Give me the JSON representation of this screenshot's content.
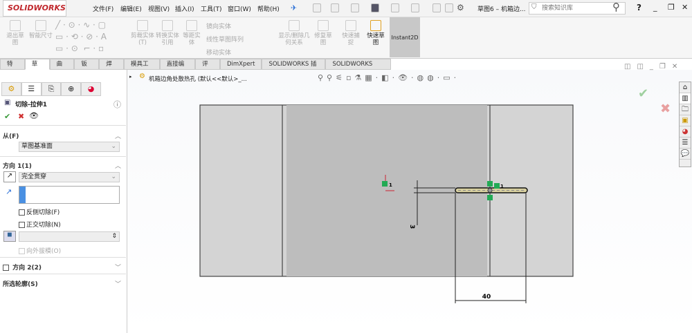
{
  "app": {
    "logo": "SOLIDWORKS",
    "document_title": "草图6 – 机箱边...",
    "search_placeholder": "搜索知识库",
    "help": "?"
  },
  "menu": [
    "文件(F)",
    "编辑(E)",
    "视图(V)",
    "插入(I)",
    "工具(T)",
    "窗口(W)",
    "帮助(H)"
  ],
  "ribbon": {
    "exit_sketch": "退出草图",
    "smart_dim": "智能尺寸",
    "trim": "剪裁实体(T)",
    "convert": "转换实体引用",
    "offset": "等距实体",
    "mirror": "镜向实体",
    "linear_pattern": "线性草图阵列",
    "move": "移动实体",
    "display_relations": "显示/删除几何关系",
    "repair": "修复草图",
    "quick_snap": "快速捕捉",
    "rapid_sketch": "快速草图",
    "instant2d": "Instant2D"
  },
  "tabs": [
    "特征",
    "草图",
    "曲面",
    "钣金",
    "焊件",
    "模具工具",
    "直接编辑",
    "评估",
    "DimXpert",
    "SOLIDWORKS 插件",
    "SOLIDWORKS MBD"
  ],
  "active_tab": 1,
  "panel": {
    "feature_title": "切除-拉伸1",
    "from_label": "从(F)",
    "from_value": "草图基准面",
    "dir1_label": "方向 1(1)",
    "dir1_value": "完全贯穿",
    "flip_side": "反侧切除(F)",
    "normal_cut": "正交切除(N)",
    "draft_outward": "向外拔模(O)",
    "dir2_label": "方向 2(2)",
    "contours_label": "所选轮廓(S)"
  },
  "tree": {
    "item": "机箱边角处散热孔 (默认<<默认>_..."
  },
  "drawing": {
    "dim_width": "40",
    "dim_height": "3",
    "relation_label": "1"
  },
  "colors": {
    "accent": "#1e90ff",
    "confirm": "#3a9a3a",
    "cancel": "#d03030",
    "sketch_dark": "#bdbdbd",
    "sketch_light": "#d4d4d4"
  }
}
